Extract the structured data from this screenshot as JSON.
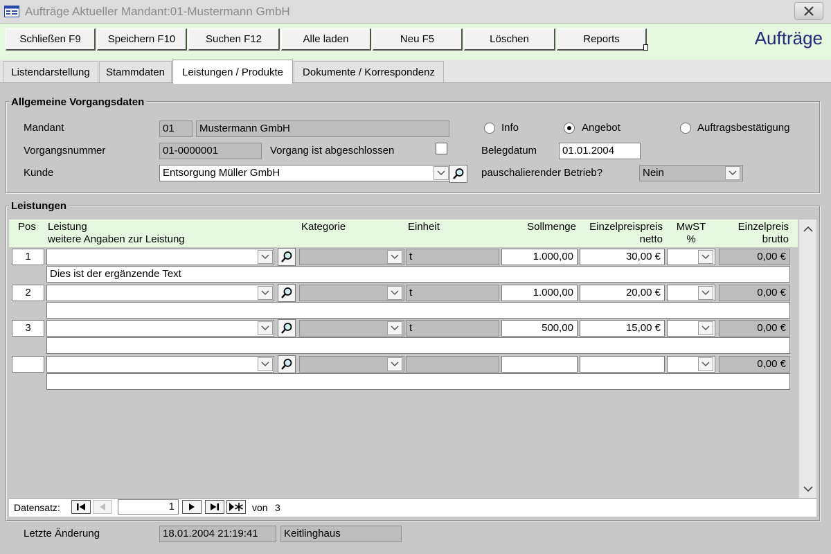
{
  "window": {
    "title": "Aufträge Aktueller Mandant:01-Mustermann GmbH"
  },
  "toolbar": {
    "buttons": [
      {
        "label": "Schließen F9"
      },
      {
        "label": "Speichern F10"
      },
      {
        "label": "Suchen F12"
      },
      {
        "label": "Alle laden"
      },
      {
        "label": "Neu F5"
      },
      {
        "label": "Löschen"
      },
      {
        "label": "Reports"
      }
    ],
    "brand": "Aufträge"
  },
  "tabs": [
    {
      "label": "Listendarstellung",
      "active": false
    },
    {
      "label": "Stammdaten",
      "active": false
    },
    {
      "label": "Leistungen / Produkte",
      "active": true
    },
    {
      "label": "Dokumente / Korrespondenz",
      "active": false
    }
  ],
  "general": {
    "title": "Allgemeine Vorgangsdaten",
    "mandant_label": "Mandant",
    "mandant_code": "01",
    "mandant_name": "Mustermann GmbH",
    "vorgang_label": "Vorgangsnummer",
    "vorgang_value": "01-0000001",
    "closed_label": "Vorgang ist abgeschlossen",
    "closed_checked": false,
    "kunde_label": "Kunde",
    "kunde_value": "Entsorgung Müller GmbH",
    "radios": [
      {
        "label": "Info",
        "selected": false
      },
      {
        "label": "Angebot",
        "selected": true
      },
      {
        "label": "Auftragsbestätigung",
        "selected": false
      }
    ],
    "belegdatum_label": "Belegdatum",
    "belegdatum_value": "01.01.2004",
    "pauschal_label": "pauschalierender Betrieb?",
    "pauschal_value": "Nein"
  },
  "leistungen": {
    "title": "Leistungen",
    "columns": {
      "pos": "Pos",
      "leistung": "Leistung",
      "leistung_sub": "weitere Angaben zur Leistung",
      "kategorie": "Kategorie",
      "einheit": "Einheit",
      "sollmenge": "Sollmenge",
      "netto_1": "Einzelpreispreis",
      "netto_2": "netto",
      "mwst_1": "MwST",
      "mwst_2": "%",
      "brutto_1": "Einzelpreis",
      "brutto_2": "brutto"
    },
    "rows": [
      {
        "pos": "1",
        "leistung": "",
        "kategorie": "",
        "einheit": "t",
        "sollmenge": "1.000,00",
        "netto": "30,00 €",
        "mwst": "",
        "brutto": "0,00 €",
        "text": "Dies ist der ergänzende Text"
      },
      {
        "pos": "2",
        "leistung": "",
        "kategorie": "",
        "einheit": "t",
        "sollmenge": "1.000,00",
        "netto": "20,00 €",
        "mwst": "",
        "brutto": "0,00 €",
        "text": ""
      },
      {
        "pos": "3",
        "leistung": "",
        "kategorie": "",
        "einheit": "t",
        "sollmenge": "500,00",
        "netto": "15,00 €",
        "mwst": "",
        "brutto": "0,00 €",
        "text": ""
      },
      {
        "pos": "",
        "leistung": "",
        "kategorie": "",
        "einheit": "",
        "sollmenge": "",
        "netto": "",
        "mwst": "",
        "brutto": "0,00 €",
        "text": ""
      }
    ]
  },
  "navigator": {
    "label": "Datensatz:",
    "current": "1",
    "of_label": "von",
    "total": "3"
  },
  "footer": {
    "label": "Letzte Änderung",
    "timestamp": "18.01.2004 21:19:41",
    "user": "Keitlinghaus"
  },
  "colors": {
    "toolbar_bg": "#e5f7de",
    "brand": "#1f2c7a",
    "body_bg": "#c8c8c8"
  }
}
